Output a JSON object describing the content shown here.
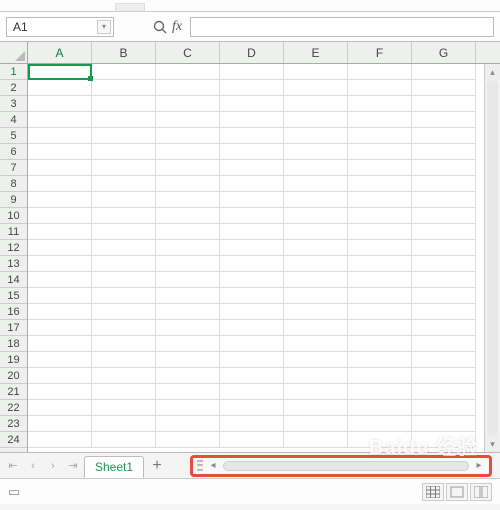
{
  "name_box": {
    "value": "A1"
  },
  "fx": {
    "label": "fx",
    "value": ""
  },
  "columns": [
    "A",
    "B",
    "C",
    "D",
    "E",
    "F",
    "G"
  ],
  "rows": [
    "1",
    "2",
    "3",
    "4",
    "5",
    "6",
    "7",
    "8",
    "9",
    "10",
    "11",
    "12",
    "13",
    "14",
    "15",
    "16",
    "17",
    "18",
    "19",
    "20",
    "21",
    "22",
    "23",
    "24"
  ],
  "active": {
    "col": "A",
    "row": "1"
  },
  "sheets": {
    "active": "Sheet1",
    "add_label": "+"
  },
  "nav": {
    "first": "⇤",
    "prev": "‹",
    "next": "›",
    "last": "⇥"
  },
  "hscroll": {
    "left": "◂",
    "right": "▸"
  },
  "vscroll": {
    "up": "▴",
    "down": "▾"
  },
  "watermark": "Baidu 经验"
}
